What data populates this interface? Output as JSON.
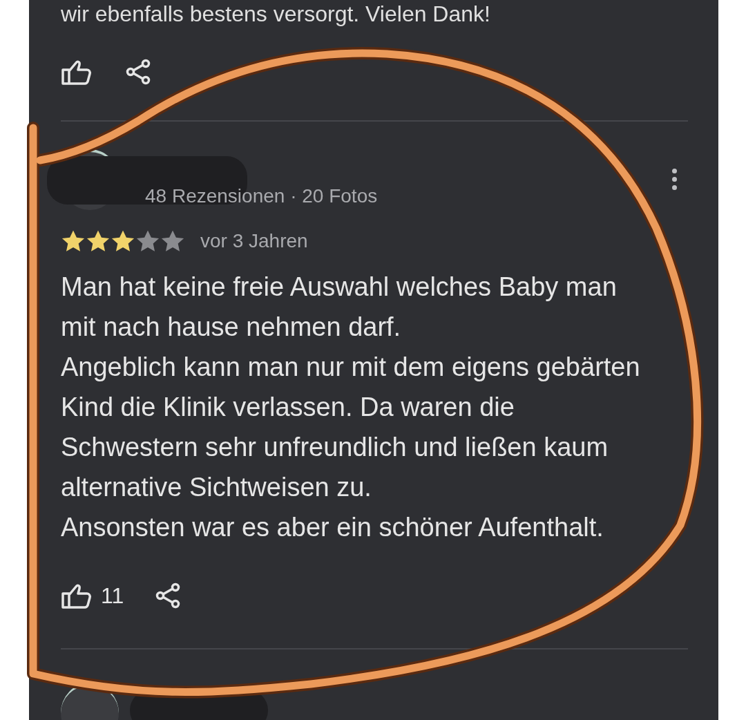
{
  "previous_review": {
    "text_tail": "wir ebenfalls bestens versorgt. Vielen Dank!"
  },
  "review": {
    "meta": "48 Rezensionen · 20 Fotos",
    "stars": 3,
    "time": "vor 3 Jahren",
    "paragraphs": [
      "Man hat keine freie Auswahl welches Baby man mit nach hause nehmen darf.",
      "Angeblich kann man nur mit dem eigens gebärten Kind die Klinik verlassen. Da waren die Schwestern sehr unfreundlich und ließen kaum alternative Sichtweisen zu.",
      "Ansonsten war es aber ein schöner Aufenthalt."
    ],
    "likes": "11"
  }
}
